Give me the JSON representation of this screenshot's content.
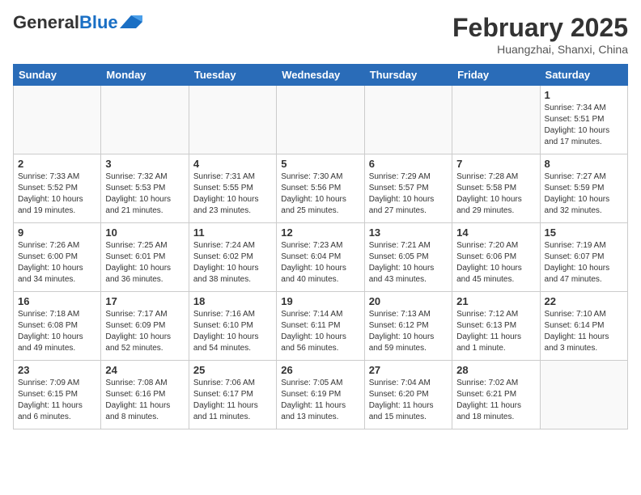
{
  "header": {
    "logo_general": "General",
    "logo_blue": "Blue",
    "month_year": "February 2025",
    "location": "Huangzhai, Shanxi, China"
  },
  "days_of_week": [
    "Sunday",
    "Monday",
    "Tuesday",
    "Wednesday",
    "Thursday",
    "Friday",
    "Saturday"
  ],
  "weeks": [
    [
      {
        "day": "",
        "info": ""
      },
      {
        "day": "",
        "info": ""
      },
      {
        "day": "",
        "info": ""
      },
      {
        "day": "",
        "info": ""
      },
      {
        "day": "",
        "info": ""
      },
      {
        "day": "",
        "info": ""
      },
      {
        "day": "1",
        "info": "Sunrise: 7:34 AM\nSunset: 5:51 PM\nDaylight: 10 hours and 17 minutes."
      }
    ],
    [
      {
        "day": "2",
        "info": "Sunrise: 7:33 AM\nSunset: 5:52 PM\nDaylight: 10 hours and 19 minutes."
      },
      {
        "day": "3",
        "info": "Sunrise: 7:32 AM\nSunset: 5:53 PM\nDaylight: 10 hours and 21 minutes."
      },
      {
        "day": "4",
        "info": "Sunrise: 7:31 AM\nSunset: 5:55 PM\nDaylight: 10 hours and 23 minutes."
      },
      {
        "day": "5",
        "info": "Sunrise: 7:30 AM\nSunset: 5:56 PM\nDaylight: 10 hours and 25 minutes."
      },
      {
        "day": "6",
        "info": "Sunrise: 7:29 AM\nSunset: 5:57 PM\nDaylight: 10 hours and 27 minutes."
      },
      {
        "day": "7",
        "info": "Sunrise: 7:28 AM\nSunset: 5:58 PM\nDaylight: 10 hours and 29 minutes."
      },
      {
        "day": "8",
        "info": "Sunrise: 7:27 AM\nSunset: 5:59 PM\nDaylight: 10 hours and 32 minutes."
      }
    ],
    [
      {
        "day": "9",
        "info": "Sunrise: 7:26 AM\nSunset: 6:00 PM\nDaylight: 10 hours and 34 minutes."
      },
      {
        "day": "10",
        "info": "Sunrise: 7:25 AM\nSunset: 6:01 PM\nDaylight: 10 hours and 36 minutes."
      },
      {
        "day": "11",
        "info": "Sunrise: 7:24 AM\nSunset: 6:02 PM\nDaylight: 10 hours and 38 minutes."
      },
      {
        "day": "12",
        "info": "Sunrise: 7:23 AM\nSunset: 6:04 PM\nDaylight: 10 hours and 40 minutes."
      },
      {
        "day": "13",
        "info": "Sunrise: 7:21 AM\nSunset: 6:05 PM\nDaylight: 10 hours and 43 minutes."
      },
      {
        "day": "14",
        "info": "Sunrise: 7:20 AM\nSunset: 6:06 PM\nDaylight: 10 hours and 45 minutes."
      },
      {
        "day": "15",
        "info": "Sunrise: 7:19 AM\nSunset: 6:07 PM\nDaylight: 10 hours and 47 minutes."
      }
    ],
    [
      {
        "day": "16",
        "info": "Sunrise: 7:18 AM\nSunset: 6:08 PM\nDaylight: 10 hours and 49 minutes."
      },
      {
        "day": "17",
        "info": "Sunrise: 7:17 AM\nSunset: 6:09 PM\nDaylight: 10 hours and 52 minutes."
      },
      {
        "day": "18",
        "info": "Sunrise: 7:16 AM\nSunset: 6:10 PM\nDaylight: 10 hours and 54 minutes."
      },
      {
        "day": "19",
        "info": "Sunrise: 7:14 AM\nSunset: 6:11 PM\nDaylight: 10 hours and 56 minutes."
      },
      {
        "day": "20",
        "info": "Sunrise: 7:13 AM\nSunset: 6:12 PM\nDaylight: 10 hours and 59 minutes."
      },
      {
        "day": "21",
        "info": "Sunrise: 7:12 AM\nSunset: 6:13 PM\nDaylight: 11 hours and 1 minute."
      },
      {
        "day": "22",
        "info": "Sunrise: 7:10 AM\nSunset: 6:14 PM\nDaylight: 11 hours and 3 minutes."
      }
    ],
    [
      {
        "day": "23",
        "info": "Sunrise: 7:09 AM\nSunset: 6:15 PM\nDaylight: 11 hours and 6 minutes."
      },
      {
        "day": "24",
        "info": "Sunrise: 7:08 AM\nSunset: 6:16 PM\nDaylight: 11 hours and 8 minutes."
      },
      {
        "day": "25",
        "info": "Sunrise: 7:06 AM\nSunset: 6:17 PM\nDaylight: 11 hours and 11 minutes."
      },
      {
        "day": "26",
        "info": "Sunrise: 7:05 AM\nSunset: 6:19 PM\nDaylight: 11 hours and 13 minutes."
      },
      {
        "day": "27",
        "info": "Sunrise: 7:04 AM\nSunset: 6:20 PM\nDaylight: 11 hours and 15 minutes."
      },
      {
        "day": "28",
        "info": "Sunrise: 7:02 AM\nSunset: 6:21 PM\nDaylight: 11 hours and 18 minutes."
      },
      {
        "day": "",
        "info": ""
      }
    ]
  ]
}
